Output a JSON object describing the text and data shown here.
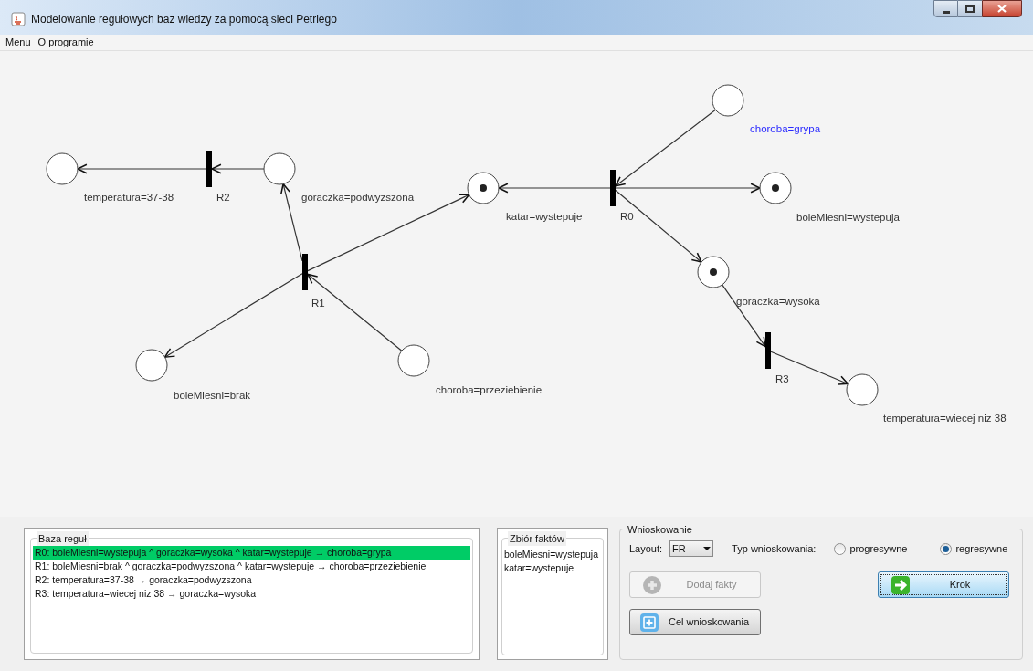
{
  "window": {
    "title": "Modelowanie regułowych baz wiedzy za pomocą sieci Petriego"
  },
  "menu": [
    {
      "label": "Menu"
    },
    {
      "label": "O programie"
    }
  ],
  "net": {
    "places": [
      {
        "label": "temperatura=37-38",
        "token": false,
        "highlighted": false
      },
      {
        "label": "goraczka=podwyzszona",
        "token": false,
        "highlighted": false
      },
      {
        "label": "katar=wystepuje",
        "token": true,
        "highlighted": false
      },
      {
        "label": "choroba=grypa",
        "token": false,
        "highlighted": true
      },
      {
        "label": "boleMiesni=wystepuja",
        "token": true,
        "highlighted": false
      },
      {
        "label": "goraczka=wysoka",
        "token": true,
        "highlighted": false
      },
      {
        "label": "boleMiesni=brak",
        "token": false,
        "highlighted": false
      },
      {
        "label": "choroba=przeziebienie",
        "token": false,
        "highlighted": false
      },
      {
        "label": "temperatura=wiecej niz 38",
        "token": false,
        "highlighted": false
      }
    ],
    "transitions": [
      {
        "label": "R2"
      },
      {
        "label": "R1"
      },
      {
        "label": "R0"
      },
      {
        "label": "R3"
      }
    ]
  },
  "rules": {
    "title": "Baza reguł",
    "items": [
      {
        "text": "R0: boleMiesni=wystepuja ^ goraczka=wysoka ^ katar=wystepuje → choroba=grypa",
        "selected": true
      },
      {
        "text": "R1: boleMiesni=brak ^ goraczka=podwyzszona ^ katar=wystepuje → choroba=przeziebienie",
        "selected": false
      },
      {
        "text": "R2: temperatura=37-38 → goraczka=podwyzszona",
        "selected": false
      },
      {
        "text": "R3: temperatura=wiecej niz 38 → goraczka=wysoka",
        "selected": false
      }
    ]
  },
  "facts": {
    "title": "Zbiór faktów",
    "items": [
      "boleMiesni=wystepuja",
      "katar=wystepuje"
    ]
  },
  "inference": {
    "title": "Wnioskowanie",
    "layout_label": "Layout:",
    "layout_value": "FR",
    "type_label": "Typ wnioskowania:",
    "types": [
      {
        "label": "progresywne",
        "selected": false
      },
      {
        "label": "regresywne",
        "selected": true
      }
    ],
    "buttons": [
      {
        "kind": "add",
        "label": "Dodaj fakty",
        "disabled": true,
        "focused": false
      },
      {
        "kind": "step",
        "label": "Krok",
        "disabled": false,
        "focused": true
      },
      {
        "kind": "target",
        "label": "Cel wnioskowania",
        "disabled": false,
        "focused": false
      }
    ]
  }
}
